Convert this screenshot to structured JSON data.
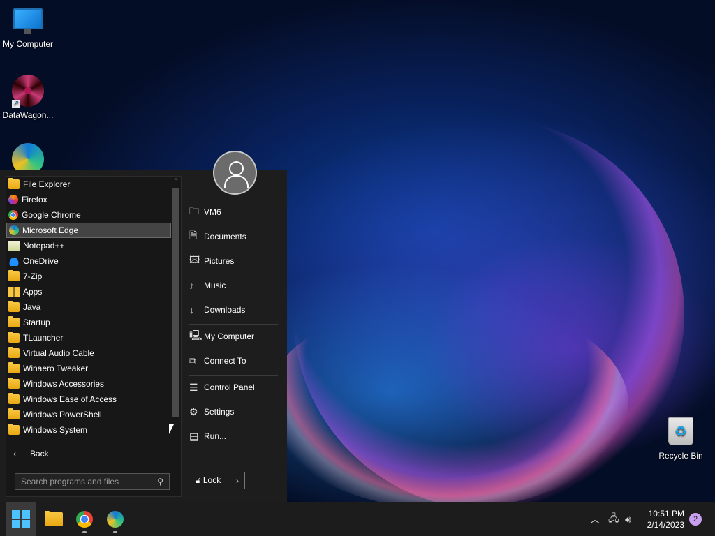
{
  "desktop": {
    "icons": [
      {
        "label": "My Computer",
        "icon": "monitor-icon"
      },
      {
        "label": "DataWagon...",
        "icon": "datawagon-icon"
      },
      {
        "label": "",
        "icon": "edge-shortcut-icon"
      },
      {
        "label": "Recycle Bin",
        "icon": "recycle-bin-icon"
      }
    ]
  },
  "start_menu": {
    "programs": [
      {
        "label": "File Explorer",
        "icon": "folder-icon"
      },
      {
        "label": "Firefox",
        "icon": "firefox-icon"
      },
      {
        "label": "Google Chrome",
        "icon": "chrome-icon"
      },
      {
        "label": "Microsoft Edge",
        "icon": "edge-icon",
        "selected": true
      },
      {
        "label": "Notepad++",
        "icon": "notepad-icon"
      },
      {
        "label": "OneDrive",
        "icon": "onedrive-icon"
      },
      {
        "label": "7-Zip",
        "icon": "folder-icon"
      },
      {
        "label": "Apps",
        "icon": "apps-icon"
      },
      {
        "label": "Java",
        "icon": "folder-icon"
      },
      {
        "label": "Startup",
        "icon": "folder-icon"
      },
      {
        "label": "TLauncher",
        "icon": "folder-icon"
      },
      {
        "label": "Virtual Audio Cable",
        "icon": "folder-icon"
      },
      {
        "label": "Winaero Tweaker",
        "icon": "folder-icon"
      },
      {
        "label": "Windows Accessories",
        "icon": "folder-icon"
      },
      {
        "label": "Windows Ease of Access",
        "icon": "folder-icon"
      },
      {
        "label": "Windows PowerShell",
        "icon": "folder-icon"
      },
      {
        "label": "Windows System",
        "icon": "folder-icon"
      }
    ],
    "back_label": "Back",
    "search_placeholder": "Search programs and files",
    "right_items": [
      {
        "label": "VM6",
        "icon": "user-folder-icon"
      },
      {
        "label": "Documents",
        "icon": "document-icon"
      },
      {
        "label": "Pictures",
        "icon": "picture-icon"
      },
      {
        "label": "Music",
        "icon": "music-icon"
      },
      {
        "label": "Downloads",
        "icon": "download-icon"
      },
      {
        "label": "My Computer",
        "icon": "computer-icon"
      },
      {
        "label": "Connect To",
        "icon": "connect-icon"
      },
      {
        "label": "Control Panel",
        "icon": "control-panel-icon"
      },
      {
        "label": "Settings",
        "icon": "settings-icon"
      },
      {
        "label": "Run...",
        "icon": "run-icon"
      }
    ],
    "lock_label": "Lock"
  },
  "taskbar": {
    "time": "10:51 PM",
    "date": "2/14/2023",
    "notification_count": "2",
    "pinned": [
      "start-icon",
      "file-explorer-icon",
      "chrome-icon",
      "edge-icon"
    ]
  }
}
